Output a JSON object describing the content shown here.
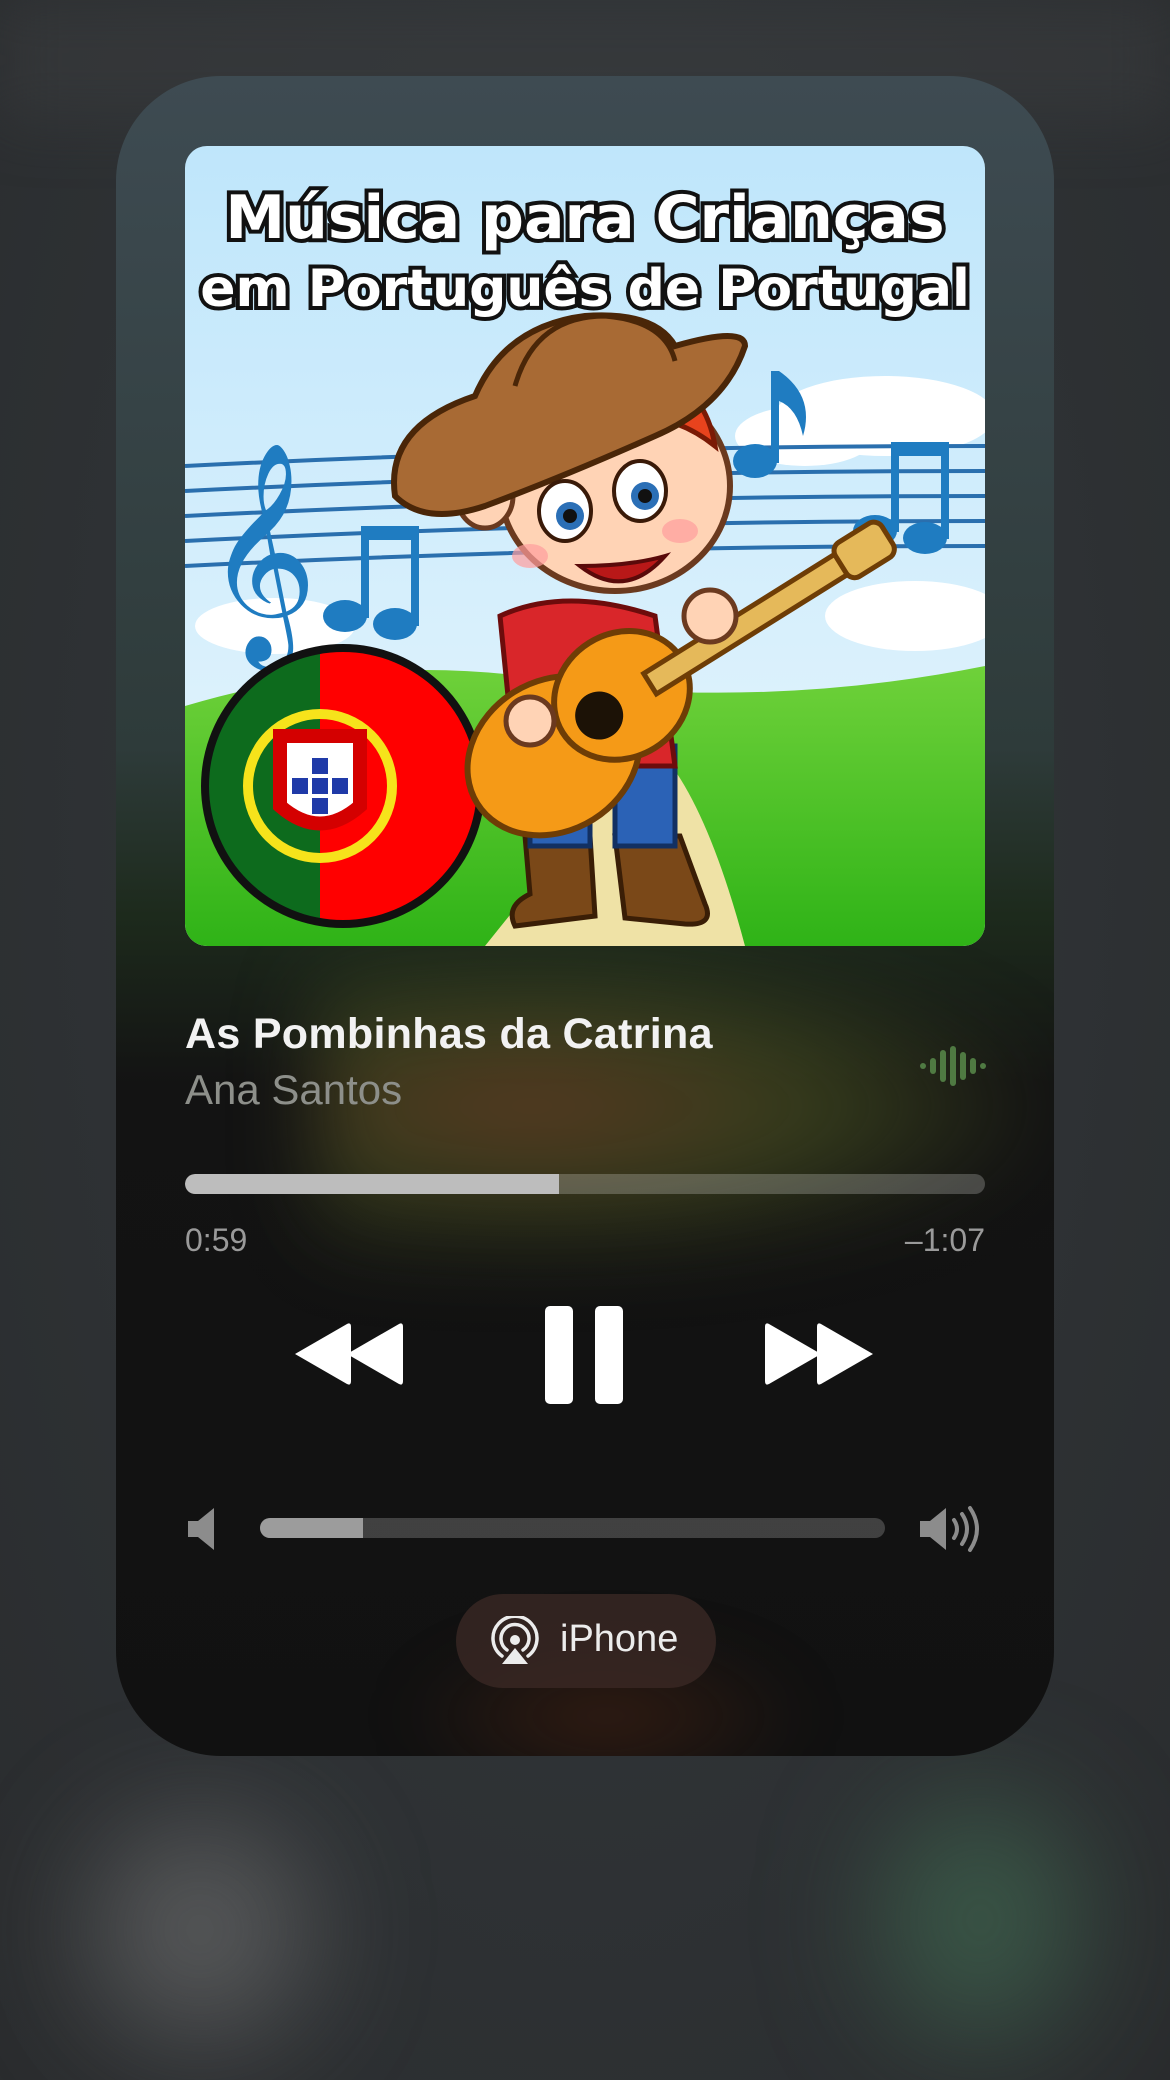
{
  "now_playing": {
    "artwork": {
      "title_line1": "Música para Crianças",
      "title_line2": "em Português de Portugal"
    },
    "song_title": "As Pombinhas da Catrina",
    "artist": "Ana Santos",
    "progress": {
      "elapsed": "0:59",
      "remaining": "–1:07",
      "fraction": 0.468
    },
    "controls": {
      "rewind_icon": "backward-icon",
      "pause_icon": "pause-icon",
      "forward_icon": "forward-icon"
    },
    "volume": {
      "level": 0.165
    },
    "output": {
      "label": "iPhone",
      "icon": "airplay-icon"
    }
  },
  "colors": {
    "accent_wave": "#4f7a42",
    "text_primary": "#f2f2f2",
    "text_secondary": "#8d8f8a"
  }
}
